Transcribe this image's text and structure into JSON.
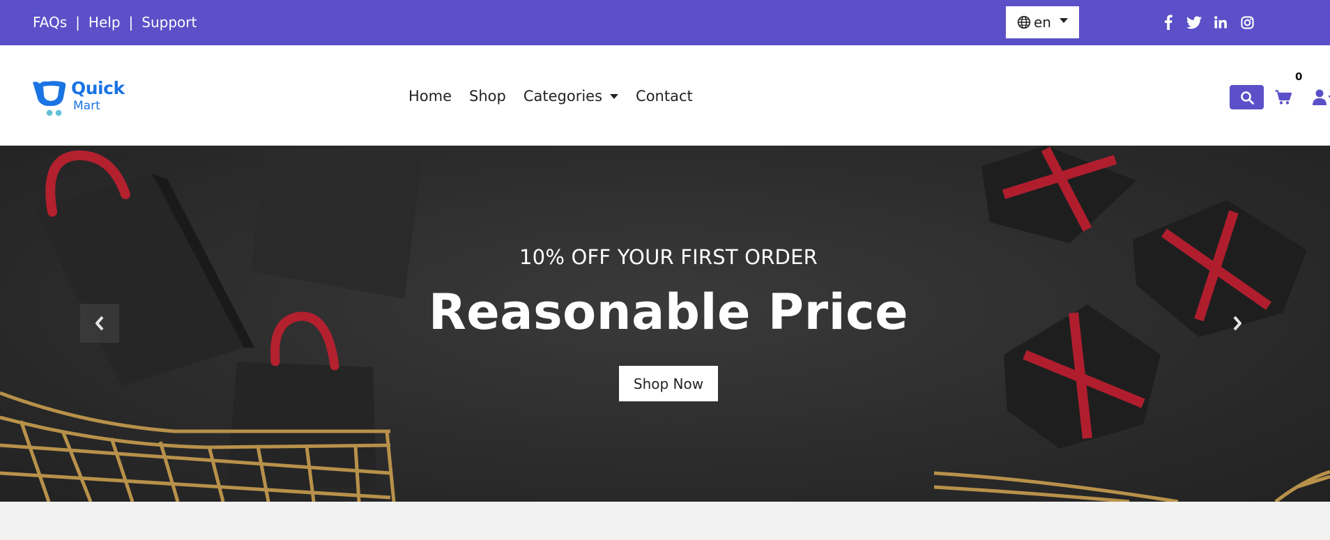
{
  "topbar": {
    "links": [
      "FAQs",
      "Help",
      "Support"
    ],
    "separator": "|",
    "language": {
      "selected": "en",
      "icon": "globe-icon"
    },
    "social": [
      {
        "name": "facebook",
        "icon": "facebook-icon"
      },
      {
        "name": "twitter",
        "icon": "twitter-icon"
      },
      {
        "name": "linkedin",
        "icon": "linkedin-icon"
      },
      {
        "name": "instagram",
        "icon": "instagram-icon"
      }
    ]
  },
  "navbar": {
    "logo": {
      "line1": "Quick",
      "line2": "Mart"
    },
    "menu": [
      "Home",
      "Shop",
      "Categories",
      "Contact"
    ],
    "search_icon": "search-icon",
    "cart": {
      "icon": "cart-icon",
      "count": "0"
    },
    "user_icon": "user-plus-icon"
  },
  "hero": {
    "subtitle": "10% OFF YOUR FIRST ORDER",
    "title": "Reasonable Price",
    "button": "Shop Now",
    "prev_icon": "chevron-left-icon",
    "next_icon": "chevron-right-icon"
  },
  "colors": {
    "brand": "#5b50c8",
    "logo": "#1b74e4",
    "ribbon": "#b01e2e",
    "gold": "#b8914a"
  }
}
